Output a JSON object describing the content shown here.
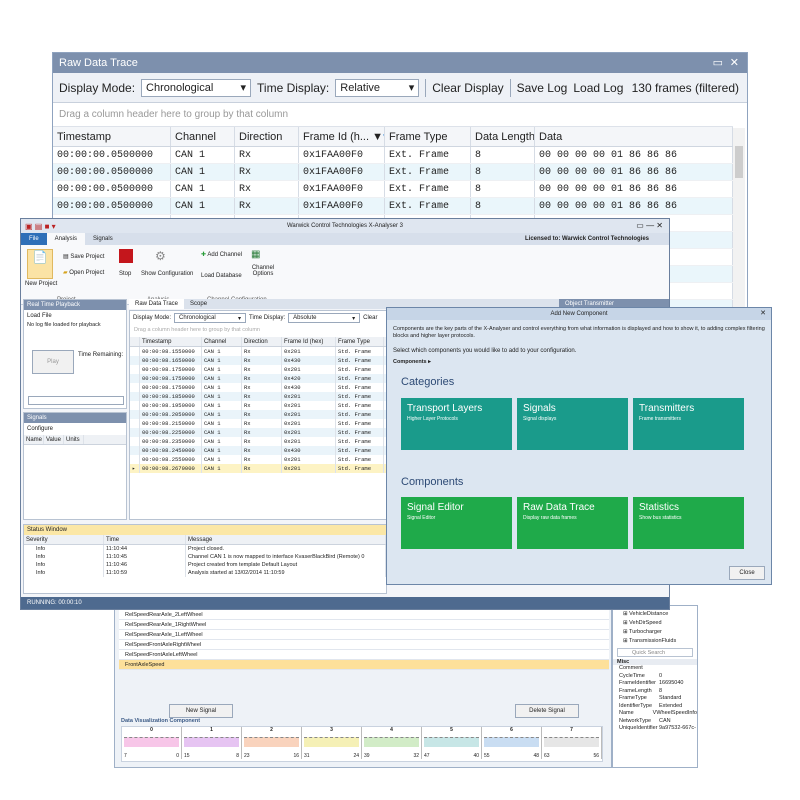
{
  "raw_trace": {
    "title": "Raw Data Trace",
    "display_mode_label": "Display Mode:",
    "display_mode_value": "Chronological",
    "time_display_label": "Time Display:",
    "time_display_value": "Relative",
    "clear_display": "Clear Display",
    "save_log": "Save Log",
    "load_log": "Load Log",
    "frame_count": "130 frames (filtered)",
    "group_hint": "Drag a column header here to group by that column",
    "columns": [
      "Timestamp",
      "Channel",
      "Direction",
      "Frame Id (h...",
      "Frame Type",
      "Data Length",
      "Data"
    ],
    "rows": [
      [
        "00:00:00.0500000",
        "CAN 1",
        "Rx",
        "0x1FAA00F0",
        "Ext. Frame",
        "8",
        "00 00 00 00 01 86 86 86"
      ],
      [
        "00:00:00.0500000",
        "CAN 1",
        "Rx",
        "0x1FAA00F0",
        "Ext. Frame",
        "8",
        "00 00 00 00 01 86 86 86"
      ],
      [
        "00:00:00.0500000",
        "CAN 1",
        "Rx",
        "0x1FAA00F0",
        "Ext. Frame",
        "8",
        "00 00 00 00 01 86 86 86"
      ],
      [
        "00:00:00.0500000",
        "CAN 1",
        "Rx",
        "0x1FAA00F0",
        "Ext. Frame",
        "8",
        "00 00 00 00 01 86 86 86"
      ]
    ]
  },
  "app": {
    "title": "Warwick Control Technologies X-Analyser 3",
    "licensed": "Licensed to: Warwick Control Technologies",
    "tabs": [
      "File",
      "Analysis",
      "Signals"
    ],
    "ribbon": {
      "new_project": "New Project",
      "save_project": "Save Project",
      "open_project": "Open Project",
      "project_group": "Project",
      "stop": "Stop",
      "show_config": "Show Configuration",
      "analysis_group": "Analysis",
      "add_channel": "Add Channel",
      "load_database": "Load Database",
      "channel_options": "Channel Options",
      "channel_group": "Channel Configuration"
    },
    "playback": {
      "title": "Real Time Playback",
      "load_file": "Load File",
      "no_log": "No log file loaded for playback",
      "play": "Play",
      "time_remaining": "Time Remaining:"
    },
    "signals": {
      "title": "Signals",
      "configure": "Configure",
      "cols": [
        "Name",
        "Value",
        "Units"
      ]
    },
    "inner_tabs": [
      "Raw Data Trace",
      "Scope",
      "Object Transmitter"
    ],
    "inner": {
      "display_mode_label": "Display Mode:",
      "display_mode_value": "Chronological",
      "time_display_label": "Time Display:",
      "time_display_value": "Absolute",
      "clear": "Clear",
      "group_hint": "Drag a column header here to group by that column",
      "columns": [
        "Timestamp",
        "Channel",
        "Direction",
        "Frame Id (hex)",
        "Frame Type"
      ],
      "rows": [
        [
          "00:00:08.1550000",
          "CAN 1",
          "Rx",
          "0x201",
          "Std. Frame"
        ],
        [
          "00:00:08.1650000",
          "CAN 1",
          "Rx",
          "0x430",
          "Std. Frame"
        ],
        [
          "00:00:08.1750000",
          "CAN 1",
          "Rx",
          "0x201",
          "Std. Frame"
        ],
        [
          "00:00:08.1750000",
          "CAN 1",
          "Rx",
          "0x420",
          "Std. Frame"
        ],
        [
          "00:00:08.1750000",
          "CAN 1",
          "Rx",
          "0x430",
          "Std. Frame"
        ],
        [
          "00:00:08.1850000",
          "CAN 1",
          "Rx",
          "0x201",
          "Std. Frame"
        ],
        [
          "00:00:08.1950000",
          "CAN 1",
          "Rx",
          "0x201",
          "Std. Frame"
        ],
        [
          "00:00:08.2050000",
          "CAN 1",
          "Rx",
          "0x201",
          "Std. Frame"
        ],
        [
          "00:00:08.2150000",
          "CAN 1",
          "Rx",
          "0x201",
          "Std. Frame"
        ],
        [
          "00:00:08.2250000",
          "CAN 1",
          "Rx",
          "0x201",
          "Std. Frame"
        ],
        [
          "00:00:08.2350000",
          "CAN 1",
          "Rx",
          "0x201",
          "Std. Frame"
        ],
        [
          "00:00:08.2450000",
          "CAN 1",
          "Rx",
          "0x430",
          "Std. Frame"
        ],
        [
          "00:00:08.2550000",
          "CAN 1",
          "Rx",
          "0x201",
          "Std. Frame"
        ],
        [
          "00:00:08.2670000",
          "CAN 1",
          "Rx",
          "0x201",
          "Std. Frame"
        ]
      ]
    },
    "status": {
      "title": "Status Window",
      "cols": [
        "Severity",
        "Time",
        "Message"
      ],
      "rows": [
        [
          "Info",
          "11:10:44",
          "Project closed."
        ],
        [
          "Info",
          "11:10:45",
          "Channel CAN 1 is now mapped to interface KvaserBlackBird (Remote) 0"
        ],
        [
          "Info",
          "11:10:46",
          "Project created from template Default Layout"
        ],
        [
          "Info",
          "11:10:59",
          "Analysis started at 13/02/2014 11:10:59"
        ]
      ]
    },
    "running": "RUNNING: 00:00:10"
  },
  "dialog": {
    "title": "Add New Component",
    "desc": "Components are the key parts of the X-Analyser and control everything from what information is displayed and how to show it, to adding complex filtering blocks and higher layer protocols.",
    "select": "Select which components you would like to add to your configuration.",
    "crumb": "Components ▸",
    "categories_h": "Categories",
    "categories": [
      {
        "t": "Transport Layers",
        "s": "Higher Layer Protocols"
      },
      {
        "t": "Signals",
        "s": "Signal displays"
      },
      {
        "t": "Transmitters",
        "s": "Frame transmitters"
      }
    ],
    "components_h": "Components",
    "components": [
      {
        "t": "Signal Editor",
        "s": "Signal Editor"
      },
      {
        "t": "Raw Data Trace",
        "s": "Display raw data frames"
      },
      {
        "t": "Statistics",
        "s": "Show bus statistics"
      }
    ],
    "close": "Close"
  },
  "signal_editor": {
    "rows": [
      "RelSpeedRearAxle_2LeftWheel",
      "RelSpeedRearAxle_1RightWheel",
      "RelSpeedRearAxle_1LeftWheel",
      "RelSpeedFrontAxleRightWheel",
      "RelSpeedFrontAxleLeftWheel",
      "FrontAxleSpeed"
    ],
    "new_signal": "New Signal",
    "delete_signal": "Delete Signal",
    "dvc": "Data Visualization Component",
    "bytes": [
      "0",
      "1",
      "2",
      "3",
      "4",
      "5",
      "6",
      "7"
    ],
    "starts": [
      "7",
      "15",
      "23",
      "31",
      "39",
      "47",
      "55",
      "63"
    ],
    "ends": [
      "0",
      "8",
      "16",
      "24",
      "32",
      "40",
      "48",
      "56"
    ],
    "byte_colors": [
      "#f7c6e8",
      "#e6c4f2",
      "#f9d3bd",
      "#f5f0b6",
      "#d2ecc7",
      "#c7e6e6",
      "#c9ddf2",
      "#e6e6e6"
    ]
  },
  "tree": {
    "items": [
      "VehicleDistance",
      "VehDirSpeed",
      "Turbocharger",
      "TransmissionFluids"
    ],
    "search": "Quick Search",
    "misc": "Misc",
    "props": [
      [
        "Comment",
        ""
      ],
      [
        "CycleTime",
        "0"
      ],
      [
        "FrameIdentifier",
        "16695040"
      ],
      [
        "FrameLength",
        "8"
      ],
      [
        "FrameType",
        "Standard"
      ],
      [
        "IdentifierType",
        "Extended"
      ],
      [
        "Name",
        "VWheelSpeedInfo"
      ],
      [
        "NetworkType",
        "CAN"
      ],
      [
        "UniqueIdentifier",
        "9a97532-667c-"
      ]
    ]
  }
}
